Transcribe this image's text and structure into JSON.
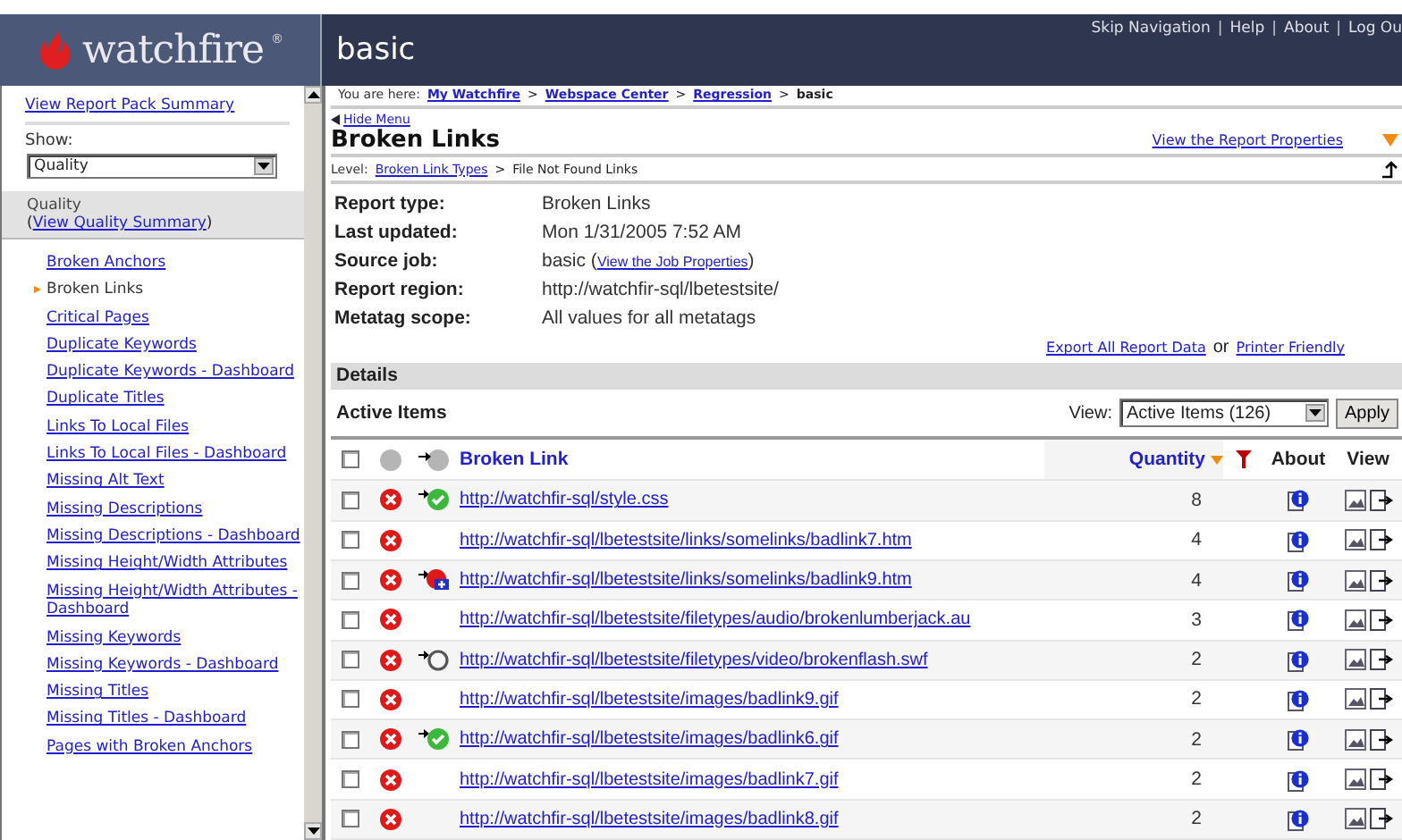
{
  "header": {
    "product": "watchfire",
    "trademark": "®",
    "site": "basic",
    "links": [
      "Skip Navigation",
      "Help",
      "About",
      "Log Ou"
    ],
    "separator": "|"
  },
  "sidebar": {
    "summary_link": "View Report Pack Summary",
    "show_label": "Show:",
    "show_value": "Quality",
    "group_title": "Quality",
    "paren_open": "(",
    "group_link": "View Quality Summary",
    "paren_close": ")",
    "items": [
      {
        "label": "Broken Anchors",
        "selected": false
      },
      {
        "label": "Broken Links",
        "selected": true
      },
      {
        "label": "Critical Pages",
        "selected": false
      },
      {
        "label": "Duplicate Keywords",
        "selected": false
      },
      {
        "label": "Duplicate Keywords - Dashboard",
        "selected": false
      },
      {
        "label": "Duplicate Titles",
        "selected": false
      },
      {
        "label": "Links To Local Files",
        "selected": false
      },
      {
        "label": "Links To Local Files - Dashboard",
        "selected": false
      },
      {
        "label": "Missing Alt Text",
        "selected": false
      },
      {
        "label": "Missing Descriptions",
        "selected": false
      },
      {
        "label": "Missing Descriptions - Dashboard",
        "selected": false
      },
      {
        "label": "Missing Height/Width Attributes",
        "selected": false
      },
      {
        "label": "Missing Height/Width Attributes - Dashboard",
        "selected": false
      },
      {
        "label": "Missing Keywords",
        "selected": false
      },
      {
        "label": "Missing Keywords - Dashboard",
        "selected": false
      },
      {
        "label": "Missing Titles",
        "selected": false
      },
      {
        "label": "Missing Titles - Dashboard",
        "selected": false
      },
      {
        "label": "Pages with Broken Anchors",
        "selected": false
      }
    ]
  },
  "breadcrumb": {
    "label": "You are here:",
    "links": [
      "My Watchfire",
      "Webspace Center",
      "Regression"
    ],
    "current": "basic",
    "separator": ">"
  },
  "hide_menu": "Hide Menu",
  "title": "Broken Links",
  "properties_link": "View the Report Properties",
  "level": {
    "label": "Level:",
    "link": "Broken Link Types",
    "current": "File Not Found Links",
    "separator": ">"
  },
  "details": [
    {
      "label": "Report type:",
      "value": "Broken Links"
    },
    {
      "label": "Last updated:",
      "value": "Mon 1/31/2005 7:52 AM"
    },
    {
      "label": "Source job:",
      "value": "basic (",
      "link": "View the Job Properties",
      "after": ")"
    },
    {
      "label": "Report region:",
      "value": "http://watchfir-sql/lbetestsite/"
    },
    {
      "label": "Metatag scope:",
      "value": "All values for all metatags"
    }
  ],
  "export_link": "Export All Report Data",
  "or": "or",
  "printer_link": "Printer Friendly",
  "details_heading": "Details",
  "active_heading": "Active Items",
  "view_label": "View:",
  "view_value": "Active Items (126)",
  "apply": "Apply",
  "table": {
    "select_all_checked": false,
    "columns": [
      "Broken Link",
      "Quantity",
      "About",
      "View"
    ],
    "rows": [
      {
        "url": "http://watchfir-sql/style.css",
        "quantity": "8",
        "checked": false,
        "kind": "fixed"
      },
      {
        "url": "http://watchfir-sql/lbetestsite/links/somelinks/badlink7.htm",
        "quantity": "4",
        "checked": false
      },
      {
        "url": "http://watchfir-sql/lbetestsite/links/somelinks/badlink9.htm",
        "quantity": "4",
        "checked": false,
        "kind": "new"
      },
      {
        "url": "http://watchfir-sql/lbetestsite/filetypes/audio/brokenlumberjack.au",
        "quantity": "3",
        "checked": false
      },
      {
        "url": "http://watchfir-sql/lbetestsite/filetypes/video/brokenflash.swf",
        "quantity": "2",
        "checked": false,
        "kind": "pending"
      },
      {
        "url": "http://watchfir-sql/lbetestsite/images/badlink9.gif",
        "quantity": "2",
        "checked": false
      },
      {
        "url": "http://watchfir-sql/lbetestsite/images/badlink6.gif",
        "quantity": "2",
        "checked": false,
        "kind": "fixed"
      },
      {
        "url": "http://watchfir-sql/lbetestsite/images/badlink7.gif",
        "quantity": "2",
        "checked": false
      },
      {
        "url": "http://watchfir-sql/lbetestsite/images/badlink8.gif",
        "quantity": "2",
        "checked": false
      }
    ]
  }
}
